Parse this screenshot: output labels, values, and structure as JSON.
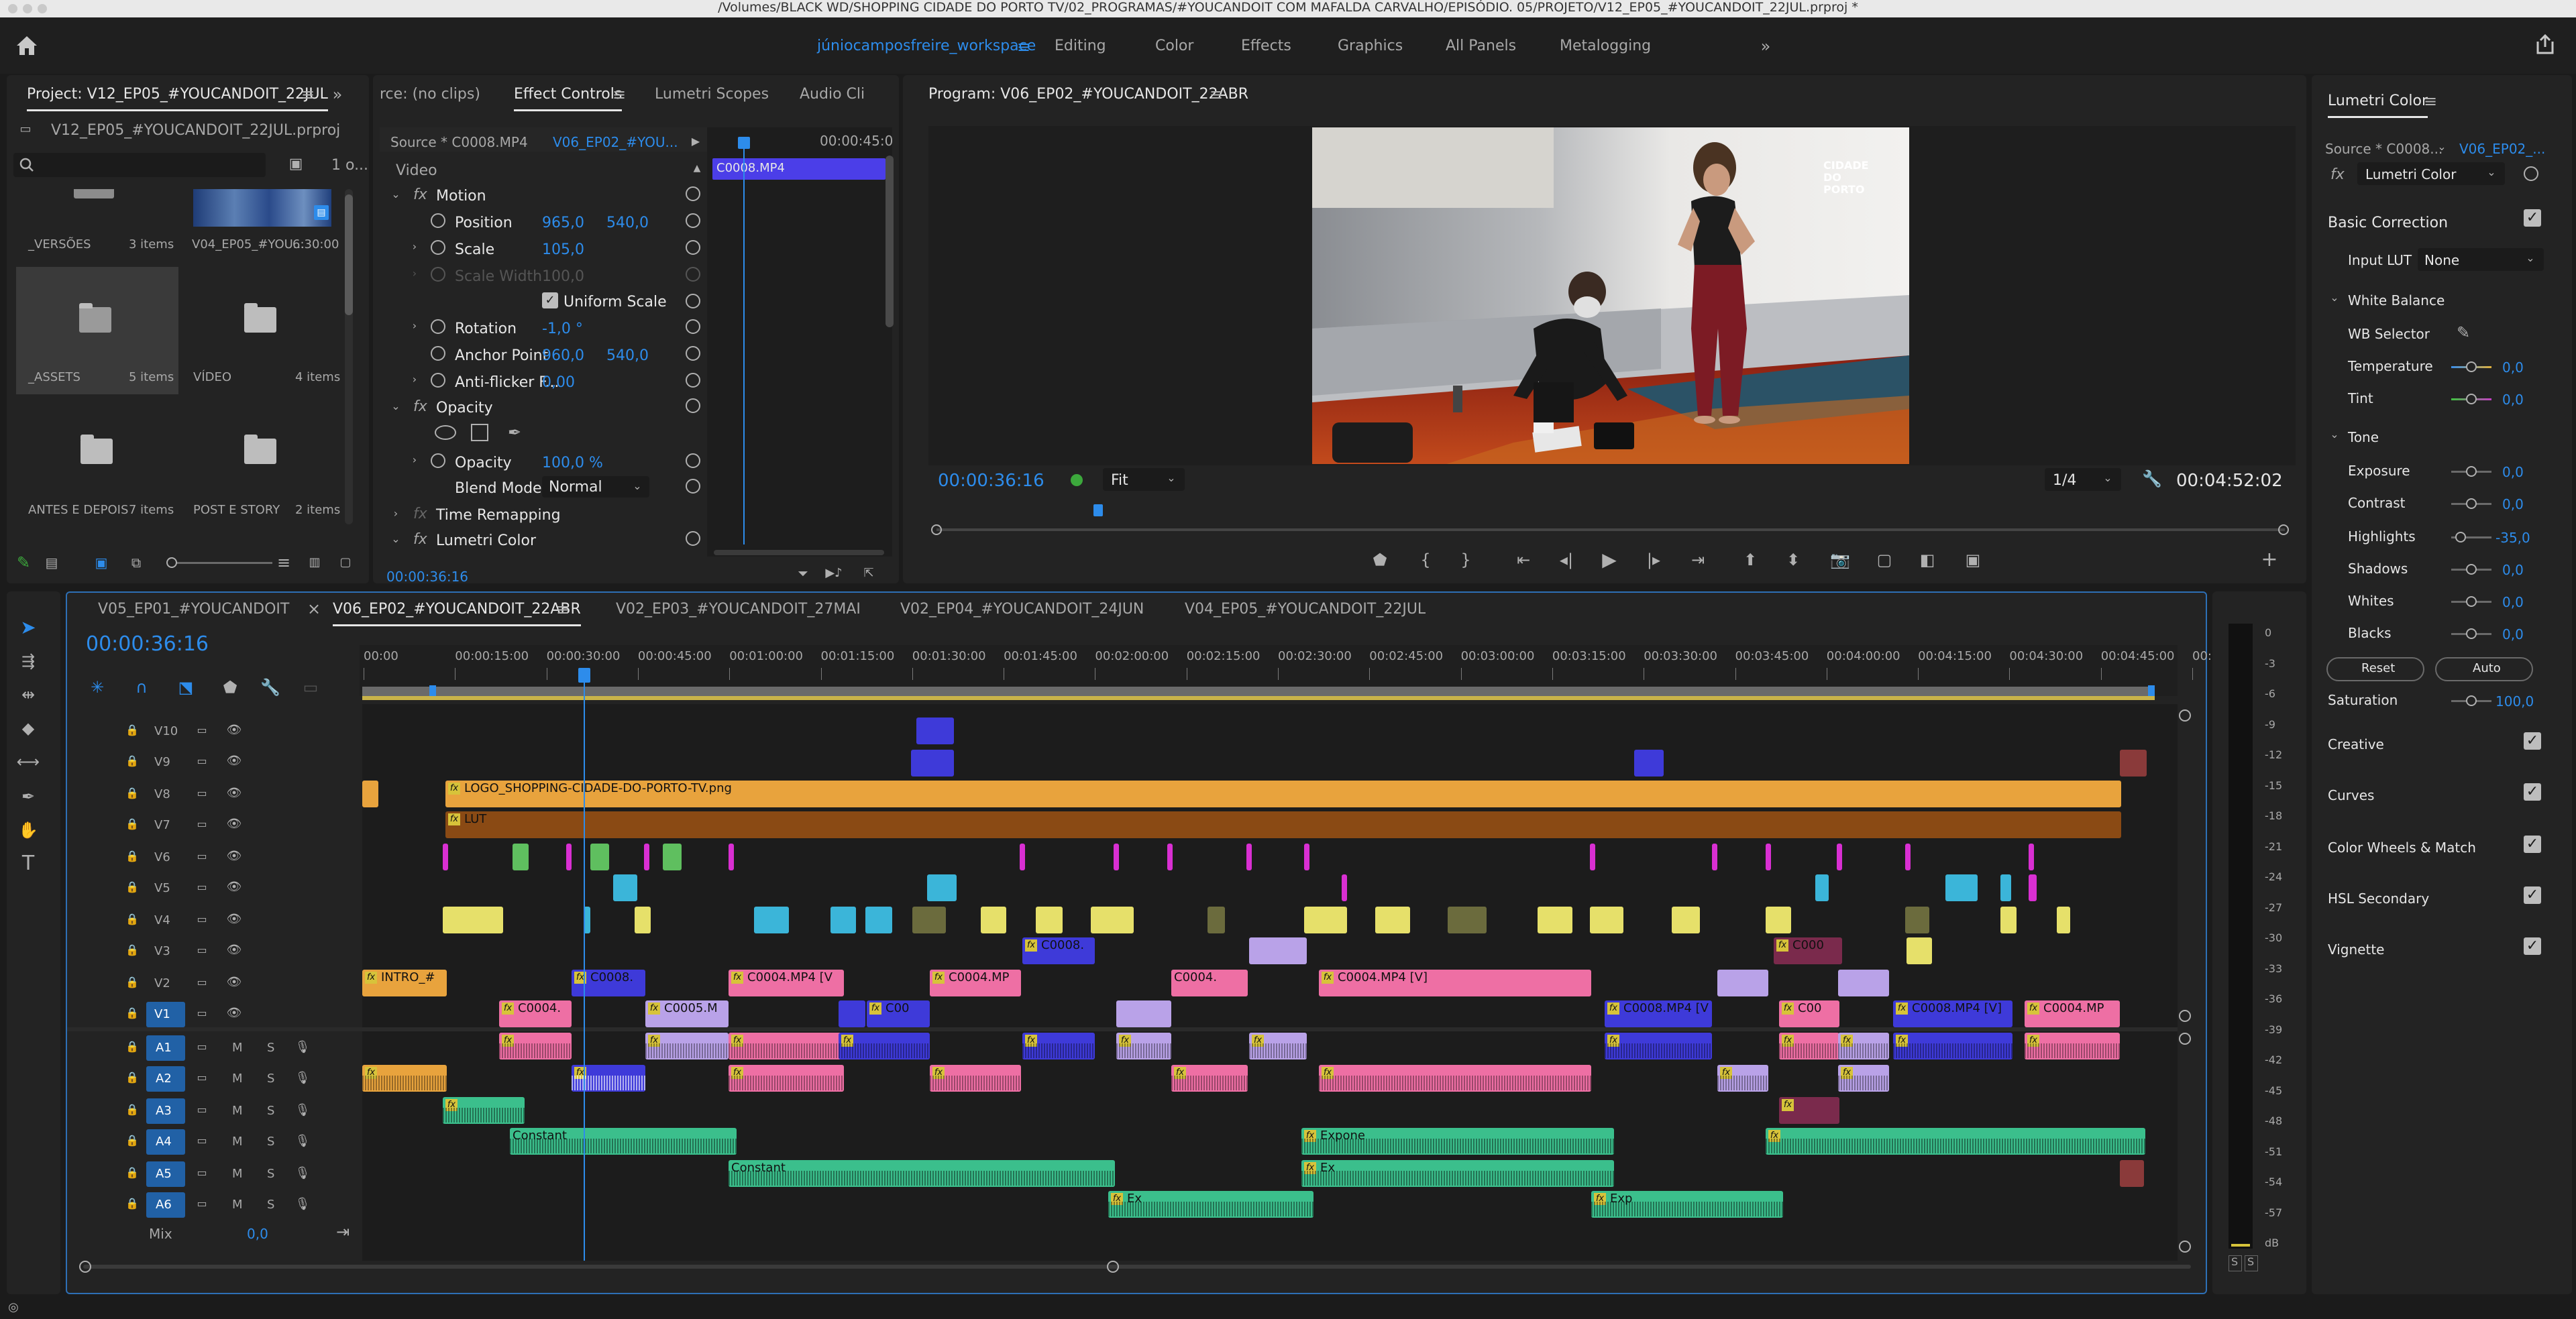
{
  "title_bar": {
    "path": "/Volumes/BLACK WD/SHOPPING CIDADE DO PORTO TV/02_PROGRAMAS/#YOUCANDOIT COM MAFALDA CARVALHO/EPISÓDIO. 05/PROJETO/V12_EP05_#YOUCANDOIT_22JUL.prproj *"
  },
  "workspaces": {
    "items": [
      "júniocamposfreire_workspace",
      "Editing",
      "Color",
      "Effects",
      "Graphics",
      "All Panels",
      "Metalogging"
    ]
  },
  "project": {
    "tab": "Project: V12_EP05_#YOUCANDOIT_22JUL",
    "file": "V12_EP05_#YOUCANDOIT_22JUL.prproj",
    "count": "1 o...",
    "bins": [
      {
        "name": "_VERSÕES",
        "info": "3 items"
      },
      {
        "name": "V04_EP05_#YOU...",
        "info": "6:30:00"
      },
      {
        "name": "_ASSETS",
        "info": "5 items"
      },
      {
        "name": "VÍDEO",
        "info": "4 items"
      },
      {
        "name": "ANTES E DEPOIS",
        "info": "7 items"
      },
      {
        "name": "POST E STORY",
        "info": "2 items"
      }
    ]
  },
  "effect_controls": {
    "tabs": [
      "rce: (no clips)",
      "Effect Controls",
      "Lumetri Scopes",
      "Audio Cli"
    ],
    "source": "Source * C0008.MP4",
    "sequence": "V06_EP02_#YOU...",
    "ruler_time": "00:00:45:0",
    "clip": "C0008.MP4",
    "section": "Video",
    "motion": "Motion",
    "position_label": "Position",
    "position_x": "965,0",
    "position_y": "540,0",
    "scale_label": "Scale",
    "scale_value": "105,0",
    "scale_width_label": "Scale Width",
    "scale_width_value": "100,0",
    "uniform_label": "Uniform Scale",
    "rotation_label": "Rotation",
    "rotation_value": "-1,0 °",
    "anchor_label": "Anchor Point",
    "anchor_x": "960,0",
    "anchor_y": "540,0",
    "antiflicker_label": "Anti-flicker F...",
    "antiflicker_value": "0,00",
    "opacity_section": "Opacity",
    "opacity_label": "Opacity",
    "opacity_value": "100,0 %",
    "blend_label": "Blend Mode",
    "blend_value": "Normal",
    "time_remap": "Time Remapping",
    "lumetri": "Lumetri Color",
    "timecode": "00:00:36:16"
  },
  "program": {
    "tab": "Program: V06_EP02_#YOUCANDOIT_22ABR",
    "timecode": "00:00:36:16",
    "fit": "Fit",
    "resolution": "1/4",
    "duration": "00:04:52:02",
    "logo_text": "CIDADE DO PORTO"
  },
  "lumetri": {
    "tab": "Lumetri Color",
    "source": "Source * C0008...",
    "sequence": "V06_EP02_...",
    "effect": "Lumetri Color",
    "basic_correction": "Basic Correction",
    "input_lut_label": "Input LUT",
    "input_lut_value": "None",
    "white_balance": "White Balance",
    "wb_selector": "WB Selector",
    "temperature_label": "Temperature",
    "temperature_value": "0,0",
    "tint_label": "Tint",
    "tint_value": "0,0",
    "tone": "Tone",
    "exposure_label": "Exposure",
    "exposure_value": "0,0",
    "contrast_label": "Contrast",
    "contrast_value": "0,0",
    "highlights_label": "Highlights",
    "highlights_value": "-35,0",
    "shadows_label": "Shadows",
    "shadows_value": "0,0",
    "whites_label": "Whites",
    "whites_value": "0,0",
    "blacks_label": "Blacks",
    "blacks_value": "0,0",
    "reset": "Reset",
    "auto": "Auto",
    "saturation_label": "Saturation",
    "saturation_value": "100,0",
    "sections": [
      "Creative",
      "Curves",
      "Color Wheels & Match",
      "HSL Secondary",
      "Vignette"
    ]
  },
  "timeline": {
    "tabs": [
      "V05_EP01_#YOUCANDOIT",
      "V06_EP02_#YOUCANDOIT_22ABR",
      "V02_EP03_#YOUCANDOIT_27MAI",
      "V02_EP04_#YOUCANDOIT_24JUN",
      "V04_EP05_#YOUCANDOIT_22JUL"
    ],
    "timecode": "00:00:36:16",
    "ruler": [
      "00:00",
      "00:00:15:00",
      "00:00:30:00",
      "00:00:45:00",
      "00:01:00:00",
      "00:01:15:00",
      "00:01:30:00",
      "00:01:45:00",
      "00:02:00:00",
      "00:02:15:00",
      "00:02:30:00",
      "00:02:45:00",
      "00:03:00:00",
      "00:03:15:00",
      "00:03:30:00",
      "00:03:45:00",
      "00:04:00:00",
      "00:04:15:00",
      "00:04:30:00",
      "00:04:45:00",
      "00:"
    ],
    "video_tracks": [
      "V10",
      "V9",
      "V8",
      "V7",
      "V6",
      "V5",
      "V4",
      "V3",
      "V2",
      "V1"
    ],
    "audio_tracks": [
      "A1",
      "A2",
      "A3",
      "A4",
      "A5",
      "A6"
    ],
    "mix_label": "Mix",
    "mix_value": "0,0",
    "clip_labels": {
      "logo": "LOGO_SHOPPING-CIDADE-DO-PORTO-TV.png",
      "lut": "LUT",
      "intro": "INTRO_#",
      "c0008": "C0008.",
      "c0004mp4v": "C0004.MP4 [V",
      "c0004mp": "C0004.MP",
      "c0004": "C0004.",
      "c0004long": "C0004.MP4 [V]",
      "c0004s": "C0004.",
      "c0005": "C0005.M",
      "c00": "C00",
      "c0008v": "C0008.MP4 [V",
      "c0008v2": "C0008.MP4 [V]",
      "c0004mp2": "C0004.MP",
      "c000": "C000",
      "constant": "Constant",
      "expone": "Expone",
      "ex": "Ex",
      "exp": "Exp"
    }
  },
  "meter": {
    "scale": [
      "0",
      "-3",
      "-6",
      "-9",
      "-12",
      "-15",
      "-18",
      "-21",
      "-24",
      "-27",
      "-30",
      "-33",
      "-36",
      "-39",
      "-42",
      "-45",
      "-48",
      "-51",
      "-54",
      "-57",
      "dB"
    ],
    "solo": "S"
  }
}
